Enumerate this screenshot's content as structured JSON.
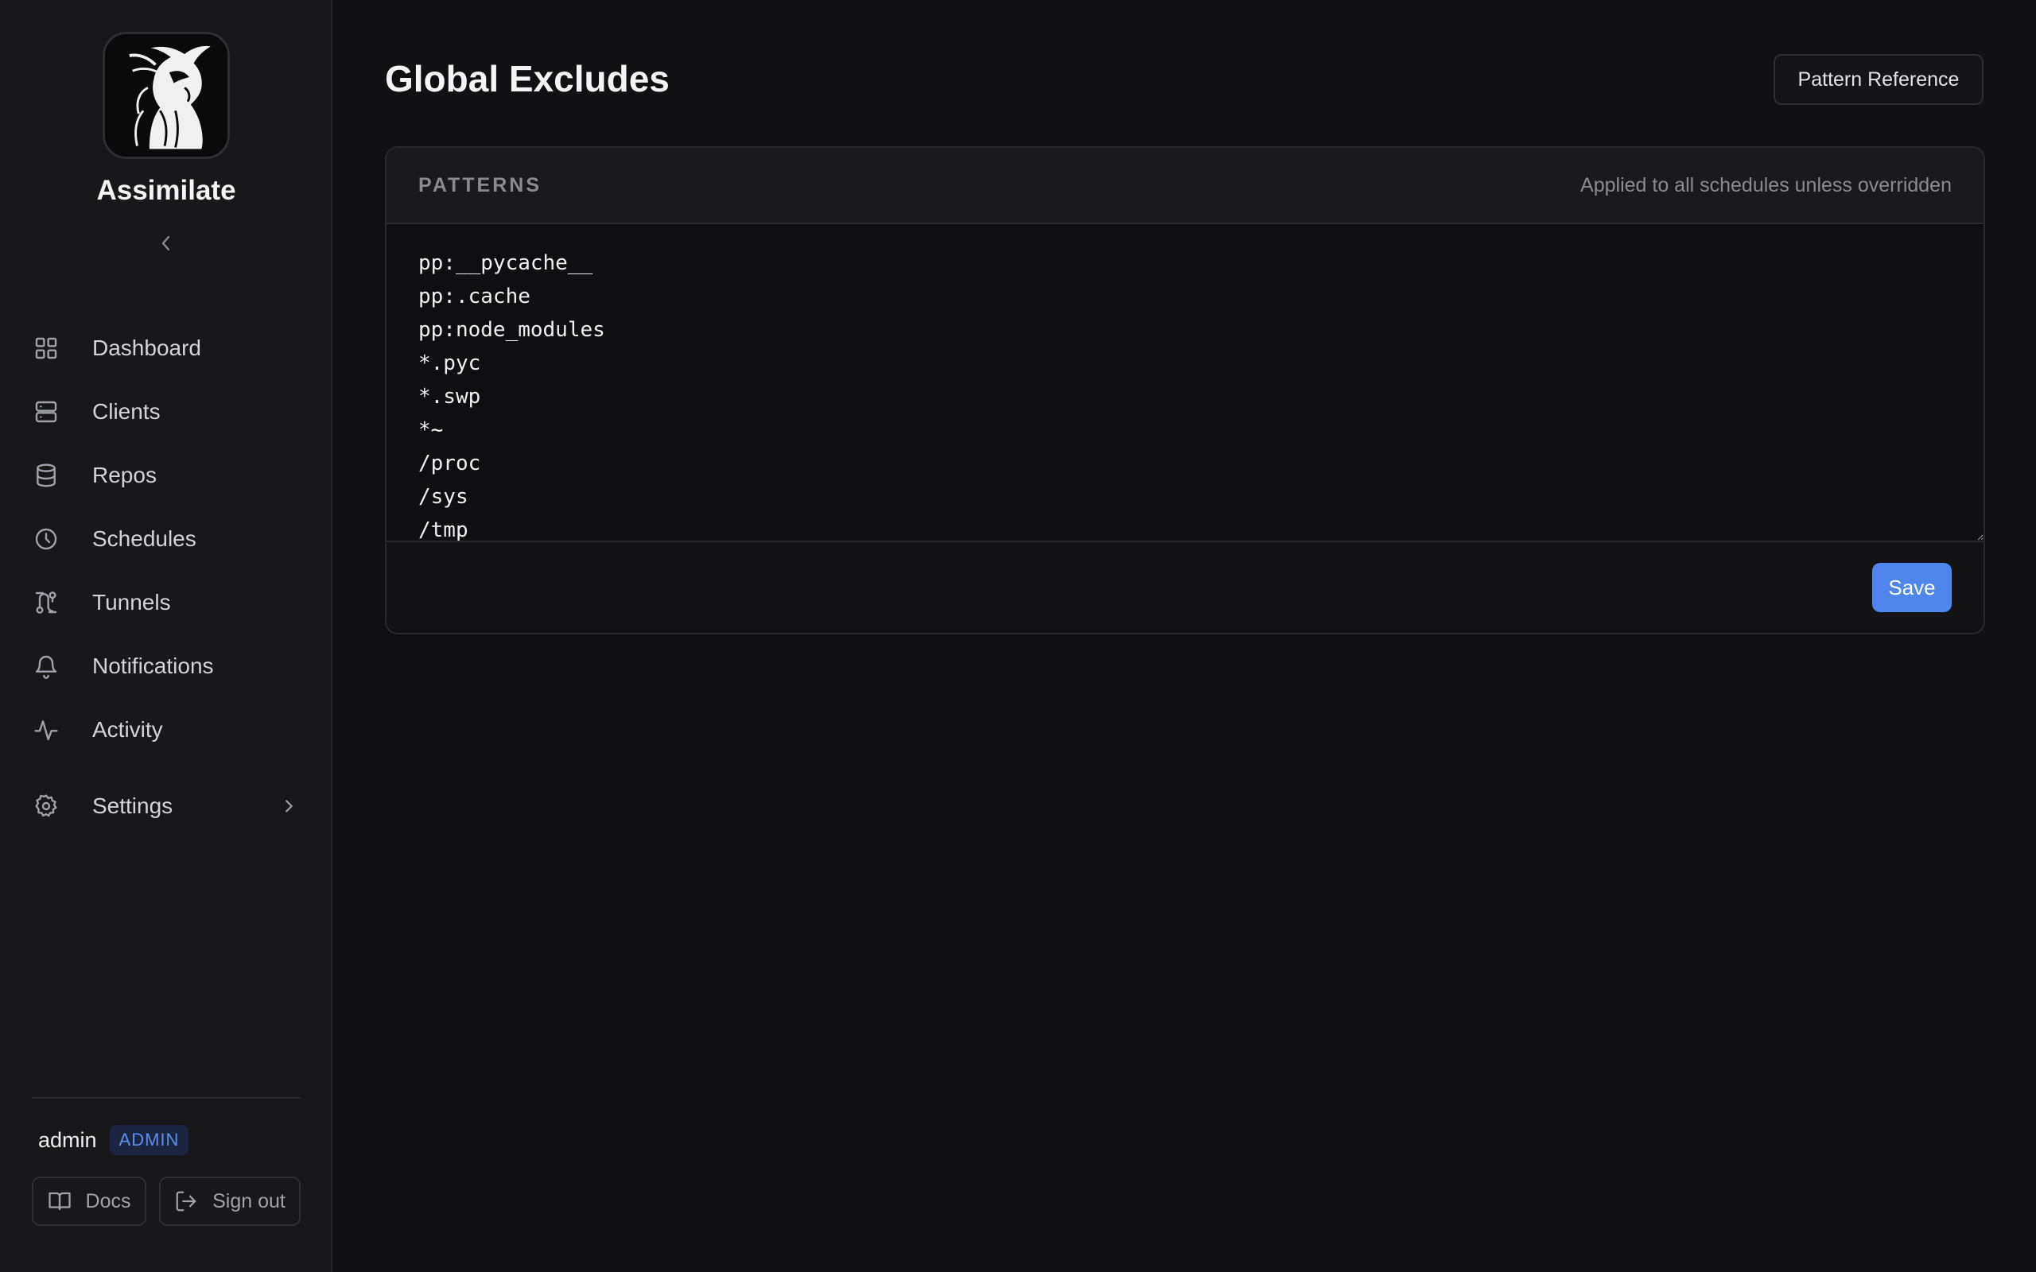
{
  "app": {
    "name": "Assimilate"
  },
  "sidebar": {
    "items": [
      {
        "label": "Dashboard",
        "icon": "grid-icon"
      },
      {
        "label": "Clients",
        "icon": "server-icon"
      },
      {
        "label": "Repos",
        "icon": "database-icon"
      },
      {
        "label": "Schedules",
        "icon": "clock-icon"
      },
      {
        "label": "Tunnels",
        "icon": "route-icon"
      },
      {
        "label": "Notifications",
        "icon": "bell-icon"
      },
      {
        "label": "Activity",
        "icon": "activity-icon"
      },
      {
        "label": "Settings",
        "icon": "gear-icon"
      }
    ],
    "user": {
      "name": "admin",
      "role": "ADMIN"
    },
    "docs_label": "Docs",
    "signout_label": "Sign out"
  },
  "page": {
    "title": "Global Excludes",
    "reference_button": "Pattern Reference"
  },
  "patterns_card": {
    "label": "PATTERNS",
    "hint": "Applied to all schedules unless overridden",
    "content": "pp:__pycache__\npp:.cache\npp:node_modules\n*.pyc\n*.swp\n*~\n/proc\n/sys\n/tmp",
    "save_label": "Save"
  },
  "colors": {
    "accent": "#4f86ec",
    "background": "#111113",
    "sidebar": "#18181b",
    "badge_text": "#5b8def"
  }
}
